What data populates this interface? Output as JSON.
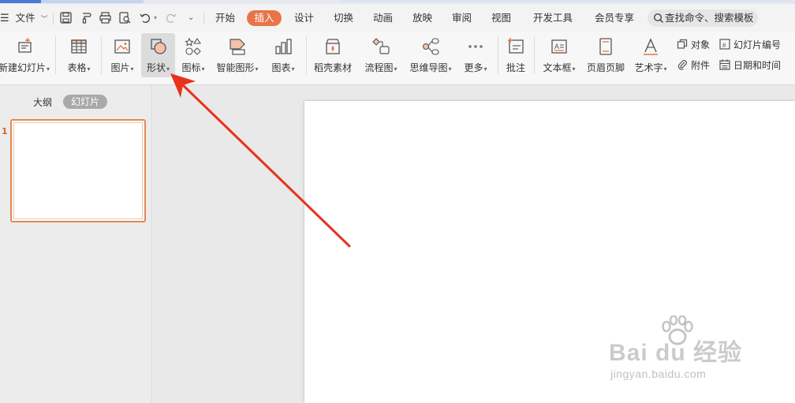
{
  "menu": {
    "file": "文件",
    "tabs": [
      "开始",
      "插入",
      "设计",
      "切换",
      "动画",
      "放映",
      "审阅",
      "视图",
      "开发工具",
      "会员专享"
    ],
    "active_tab": "插入",
    "search_placeholder": "查找命令、搜索模板"
  },
  "ribbon": {
    "new_slide": "新建幻灯片",
    "table": "表格",
    "picture": "图片",
    "shape": "形状",
    "icon": "图标",
    "smartart": "智能图形",
    "chart": "图表",
    "daoke": "稻壳素材",
    "flowchart": "流程图",
    "mindmap": "思维导图",
    "more": "更多",
    "comment": "批注",
    "textbox": "文本框",
    "header_footer": "页眉页脚",
    "wordart": "艺术字",
    "object": "对象",
    "attachment": "附件",
    "slide_number": "幻灯片编号",
    "date_time": "日期和时间"
  },
  "panel": {
    "outline_tab": "大纲",
    "slides_tab": "幻灯片",
    "slide_number": "1"
  },
  "watermark": {
    "brand": "Bai du 经验",
    "url": "jingyan.baidu.com"
  },
  "colors": {
    "accent": "#e8744a",
    "arrow": "#e8321e",
    "selection": "#e08a55"
  }
}
